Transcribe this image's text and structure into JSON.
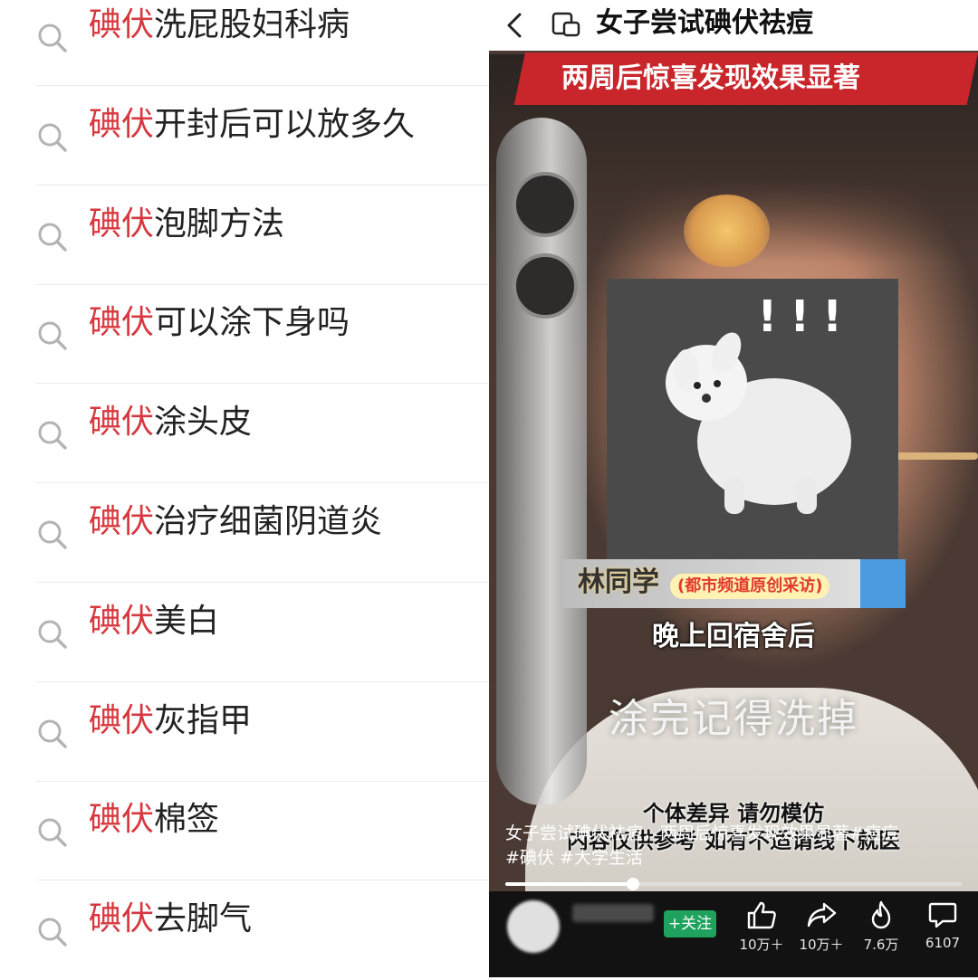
{
  "search_suggestions": {
    "highlight": "碘伏",
    "highlight_color": "#d7383f",
    "items": [
      {
        "rest": "洗屁股妇科病"
      },
      {
        "rest": "开封后可以放多久"
      },
      {
        "rest": "泡脚方法"
      },
      {
        "rest": "可以涂下身吗"
      },
      {
        "rest": "涂头皮"
      },
      {
        "rest": "治疗细菌阴道炎"
      },
      {
        "rest": "美白"
      },
      {
        "rest": "灰指甲"
      },
      {
        "rest": "棉签"
      },
      {
        "rest": "去脚气"
      }
    ]
  },
  "video": {
    "title_line1": "女子尝试碘伏祛痘",
    "title_line2": "两周后惊喜发现效果显著",
    "sticker_text": "!!!",
    "speaker_name": "林同学",
    "speaker_source": "(都市频道原创采访)",
    "subtitle_1": "晚上回宿舍后",
    "subtitle_2": "涂完记得洗掉",
    "disclaimer_1": "个体差异 请勿模仿",
    "disclaimer_2": "内容仅供参考 如有不适请线下就医",
    "caption_line1": "女子尝试碘伏祛痘，两周后惊喜发现效果显著#痘痘",
    "caption_line2": "#碘伏 #大学生活",
    "progress": 0.28
  },
  "bottom_bar": {
    "follow_label": "+关注",
    "like_count": "10万＋",
    "share_count": "10万＋",
    "fire_count": "7.6万",
    "comment_count": "6107"
  },
  "colors": {
    "banner_red": "#c9262c",
    "follow_green": "#1ea25d"
  }
}
